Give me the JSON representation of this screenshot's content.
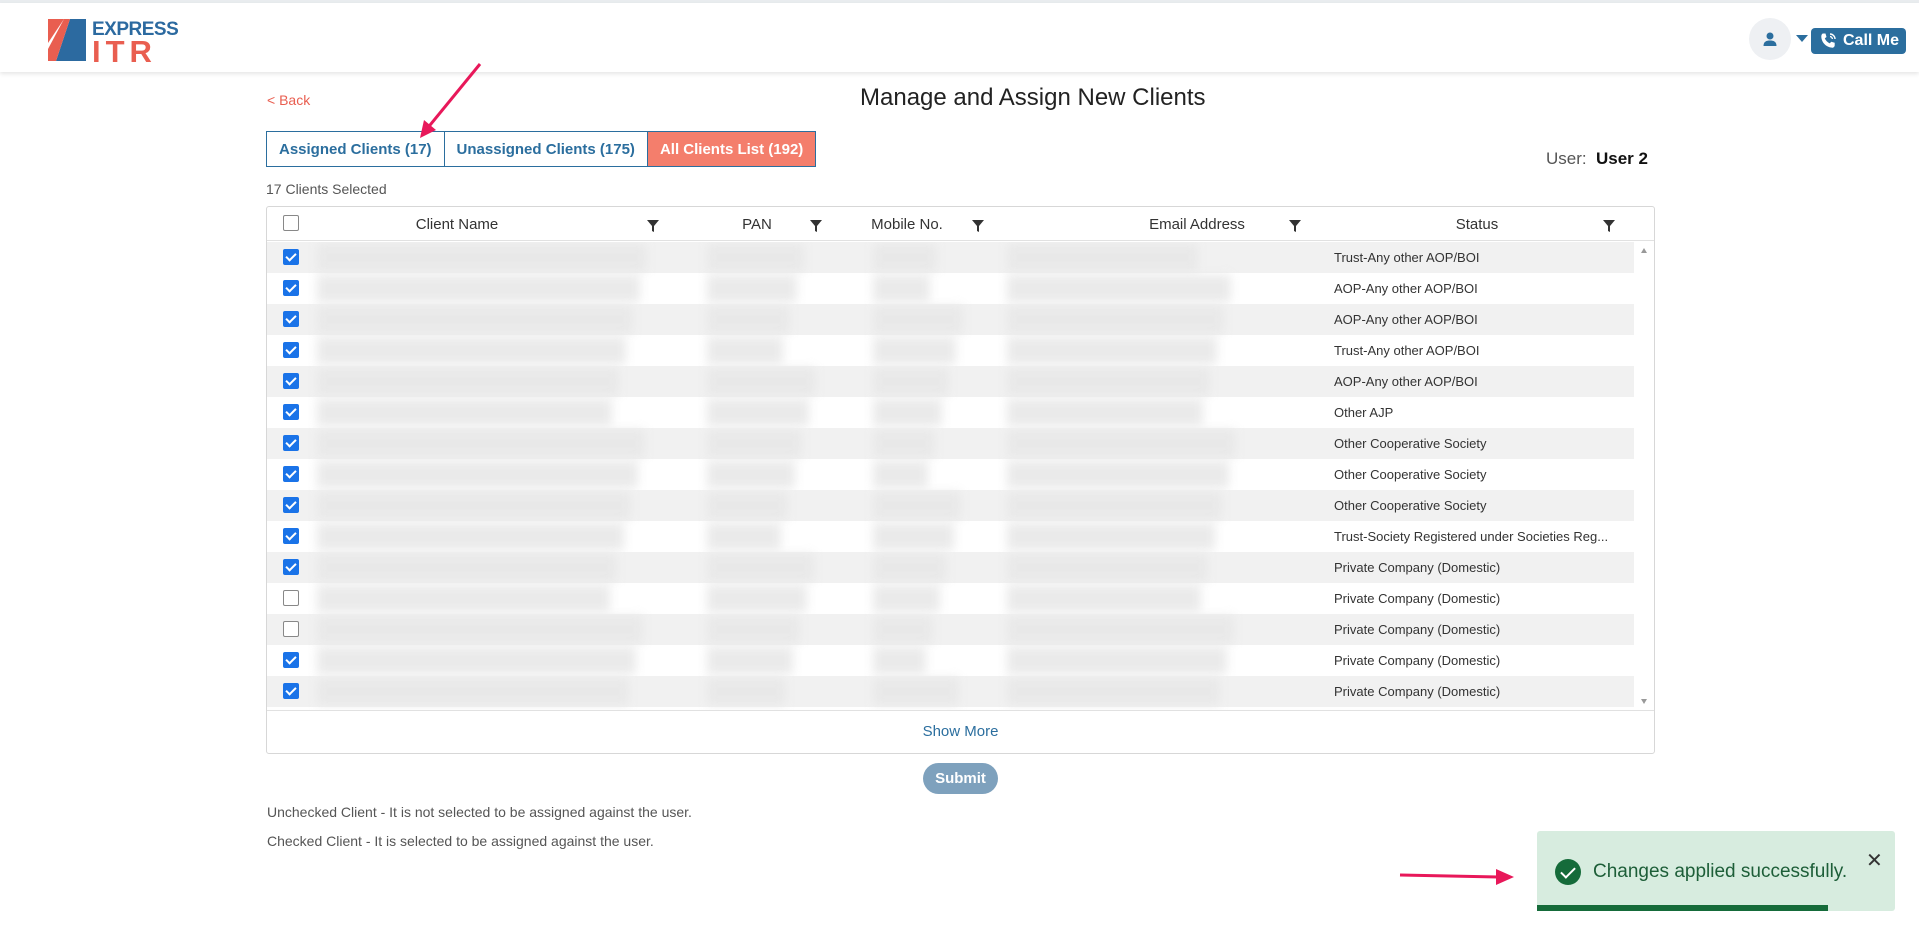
{
  "header": {
    "logo_express": "EXPRESS",
    "logo_itr": "ITR",
    "call_label": "Call Me"
  },
  "page": {
    "back_label": "< Back",
    "title": "Manage and Assign New Clients",
    "selected_count": "17 Clients Selected",
    "user_label": "User:",
    "user_value": "User 2"
  },
  "tabs": [
    {
      "label": "Assigned Clients (17)",
      "active": false
    },
    {
      "label": "Unassigned Clients (175)",
      "active": false
    },
    {
      "label": "All Clients List (192)",
      "active": true
    }
  ],
  "grid": {
    "columns": [
      "Client Name",
      "PAN",
      "Mobile No.",
      "Email Address",
      "Status"
    ],
    "rows": [
      {
        "checked": true,
        "status": "Trust-Any other AOP/BOI"
      },
      {
        "checked": true,
        "status": "AOP-Any other AOP/BOI"
      },
      {
        "checked": true,
        "status": "AOP-Any other AOP/BOI"
      },
      {
        "checked": true,
        "status": "Trust-Any other AOP/BOI"
      },
      {
        "checked": true,
        "status": "AOP-Any other AOP/BOI"
      },
      {
        "checked": true,
        "status": "Other AJP"
      },
      {
        "checked": true,
        "status": "Other Cooperative Society"
      },
      {
        "checked": true,
        "status": "Other Cooperative Society"
      },
      {
        "checked": true,
        "status": "Other Cooperative Society"
      },
      {
        "checked": true,
        "status": "Trust-Society Registered under Societies Reg..."
      },
      {
        "checked": true,
        "status": "Private Company (Domestic)"
      },
      {
        "checked": false,
        "status": "Private Company (Domestic)"
      },
      {
        "checked": false,
        "status": "Private Company (Domestic)"
      },
      {
        "checked": true,
        "status": "Private Company (Domestic)"
      },
      {
        "checked": true,
        "status": "Private Company (Domestic)"
      }
    ],
    "show_more": "Show More"
  },
  "submit_label": "Submit",
  "notes": {
    "unchecked": "Unchecked Client - It is not selected to be assigned against the user.",
    "checked": "Checked Client - It is selected to be assigned against the user."
  },
  "toast": {
    "message": "Changes applied successfully.",
    "close": "✕"
  },
  "colors": {
    "primary": "#2b6e9e",
    "accent": "#e95e50",
    "active_tab": "#f47e6c",
    "toast_bg": "#d7ecdf",
    "toast_dark": "#156b3a",
    "arrow": "#e8185a"
  }
}
